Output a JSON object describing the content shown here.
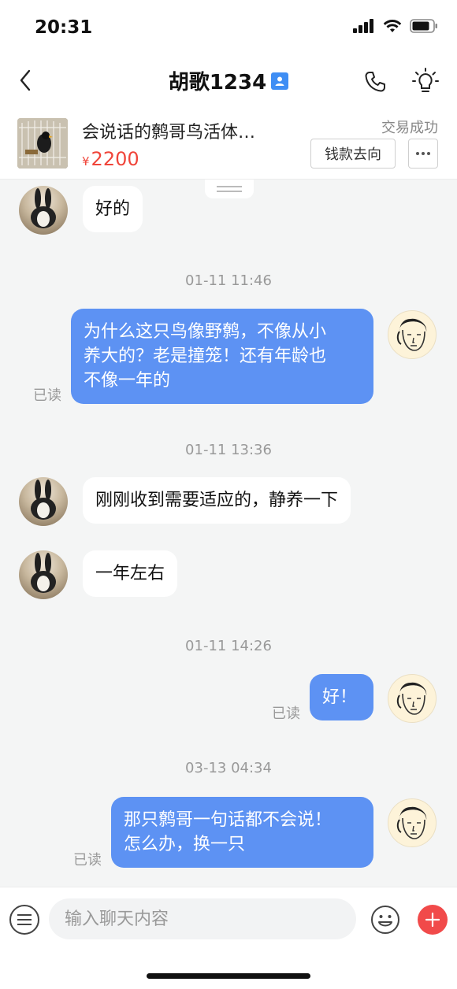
{
  "status_bar": {
    "time": "20:31"
  },
  "nav": {
    "title": "胡歌1234"
  },
  "product": {
    "title": "会说话的鹩哥鸟活体…",
    "currency": "¥",
    "price": "2200",
    "trade_status": "交易成功",
    "money_button": "钱款去向"
  },
  "messages": {
    "m1": "好的",
    "ts1": "01-11 11:46",
    "m2": "为什么这只鸟像野鹩，不像从小\n养大的？老是撞笼！还有年龄也\n不像一年的",
    "m2_read": "已读",
    "ts2": "01-11 13:36",
    "m3": "刚刚收到需要适应的，静养一下",
    "m4": "一年左右",
    "ts3": "01-11 14:26",
    "m5": "好！",
    "m5_read": "已读",
    "ts4": "03-13 04:34",
    "m6": "那只鹩哥一句话都不会说！\n怎么办，换一只",
    "m6_read": "已读"
  },
  "input": {
    "placeholder": "输入聊天内容"
  },
  "colors": {
    "accent_blue": "#5d92f3",
    "price_red": "#f0453a",
    "plus_red": "#f14a4a"
  }
}
